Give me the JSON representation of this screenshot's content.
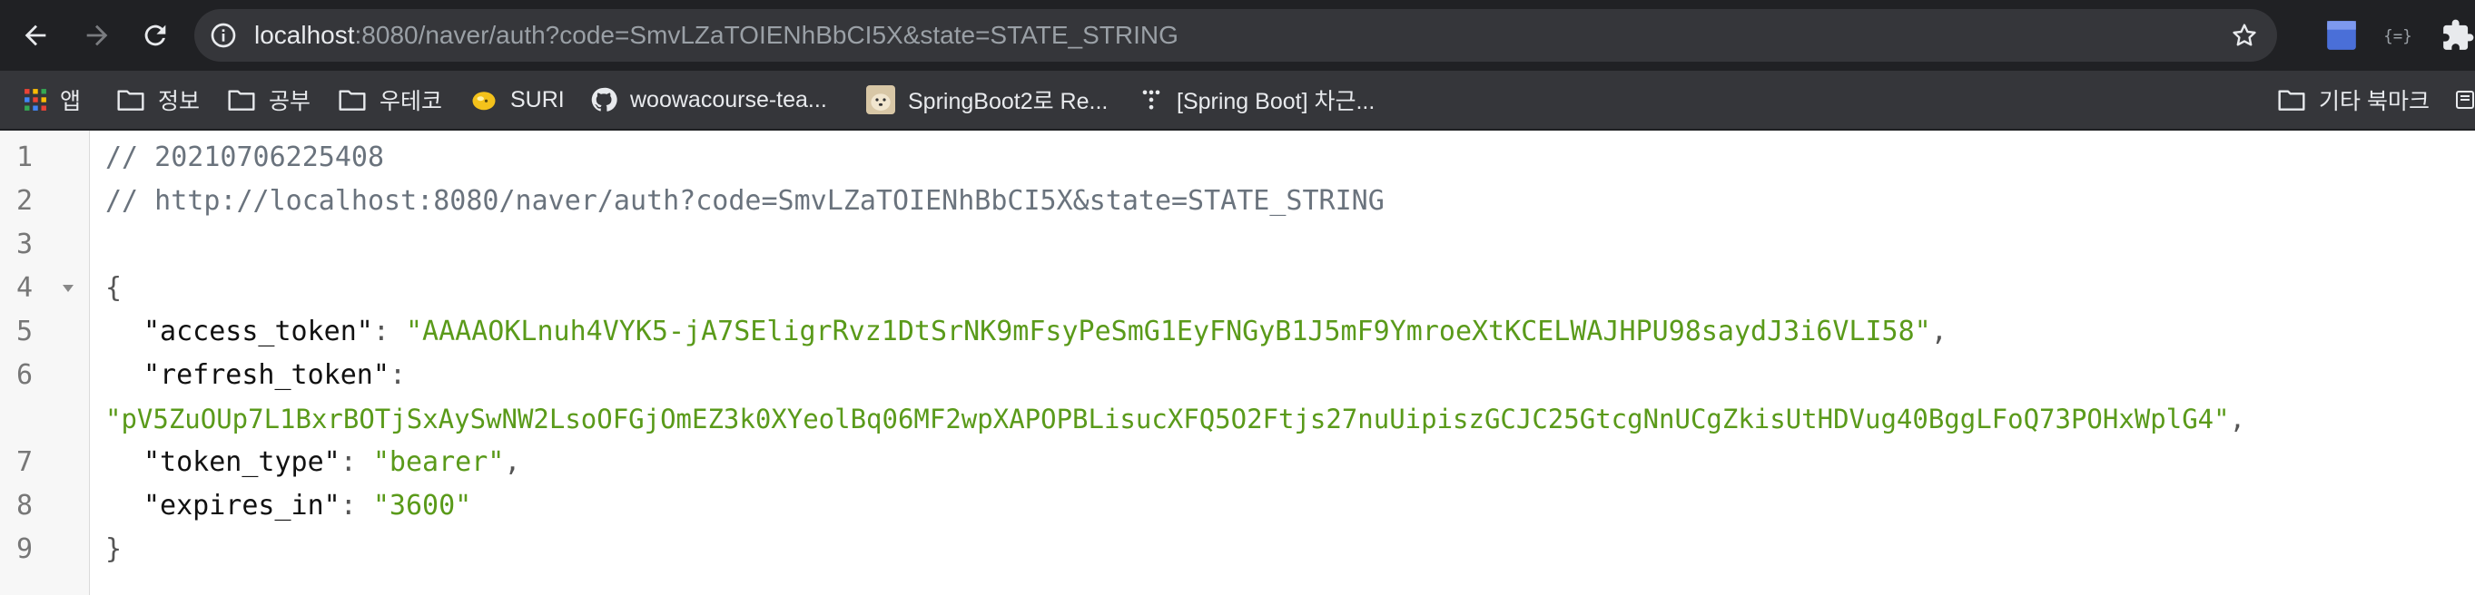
{
  "browser": {
    "url_host": "localhost",
    "url_rest": ":8080/naver/auth?code=SmvLZaTOIENhBbCI5X&state=STATE_STRING",
    "icons": {
      "back": "arrow-left-icon",
      "forward": "arrow-right-icon",
      "reload": "reload-icon",
      "info": "info-icon",
      "bookmark_star": "star-icon",
      "extensions": [
        "blue-square-extension-icon",
        "brackets-extension-icon",
        "puzzle-icon"
      ]
    }
  },
  "bookmarks": {
    "items": [
      {
        "label": "앱",
        "icon": "apps-grid-icon"
      },
      {
        "label": "정보",
        "icon": "folder-icon"
      },
      {
        "label": "공부",
        "icon": "folder-icon"
      },
      {
        "label": "우테코",
        "icon": "folder-icon"
      },
      {
        "label": "SURI",
        "icon": "lemon-favicon-icon"
      },
      {
        "label": "woowacourse-tea...",
        "icon": "github-icon"
      },
      {
        "label": "SpringBoot2로 Re...",
        "icon": "dog-favicon-icon"
      },
      {
        "label": "[Spring Boot] 차근...",
        "icon": "dots-favicon-icon"
      }
    ],
    "other": {
      "label": "기타 북마크",
      "icon": "folder-icon"
    }
  },
  "viewer": {
    "line_numbers": [
      "1",
      "2",
      "3",
      "4",
      "5",
      "6",
      "7",
      "8",
      "9"
    ],
    "comment_timestamp": "// 20210706225408",
    "comment_url": "// http://localhost:8080/naver/auth?code=SmvLZaTOIENhBbCI5X&state=STATE_STRING",
    "open_brace": "{",
    "close_brace": "}",
    "fields": {
      "access_token": {
        "key": "\"access_token\"",
        "value": "\"AAAAOKLnuh4VYK5-jA7SEligrRvz1DtSrNK9mFsyPeSmG1EyFNGyB1J5mF9YmroeXtKCELWAJHPU98saydJ3i6VLI58\""
      },
      "refresh_token": {
        "key": "\"refresh_token\"",
        "value": "\"pV5ZuOUp7L1BxrBOTjSxAySwNW2LsoOFGjOmEZ3k0XYeolBq06MF2wpXAPOPBLisucXFQ5O2Ftjs27nuUipiszGCJC25GtcgNnUCgZkisUtHDVug40BggLFoQ73POHxWplG4\""
      },
      "token_type": {
        "key": "\"token_type\"",
        "value": "\"bearer\""
      },
      "expires_in": {
        "key": "\"expires_in\"",
        "value": "\"3600\""
      }
    },
    "colon": ": ",
    "comma": ",",
    "colors": {
      "comment": "#6a737d",
      "key": "#111111",
      "string": "#5a9a1a",
      "toolbar": "#202124"
    }
  }
}
